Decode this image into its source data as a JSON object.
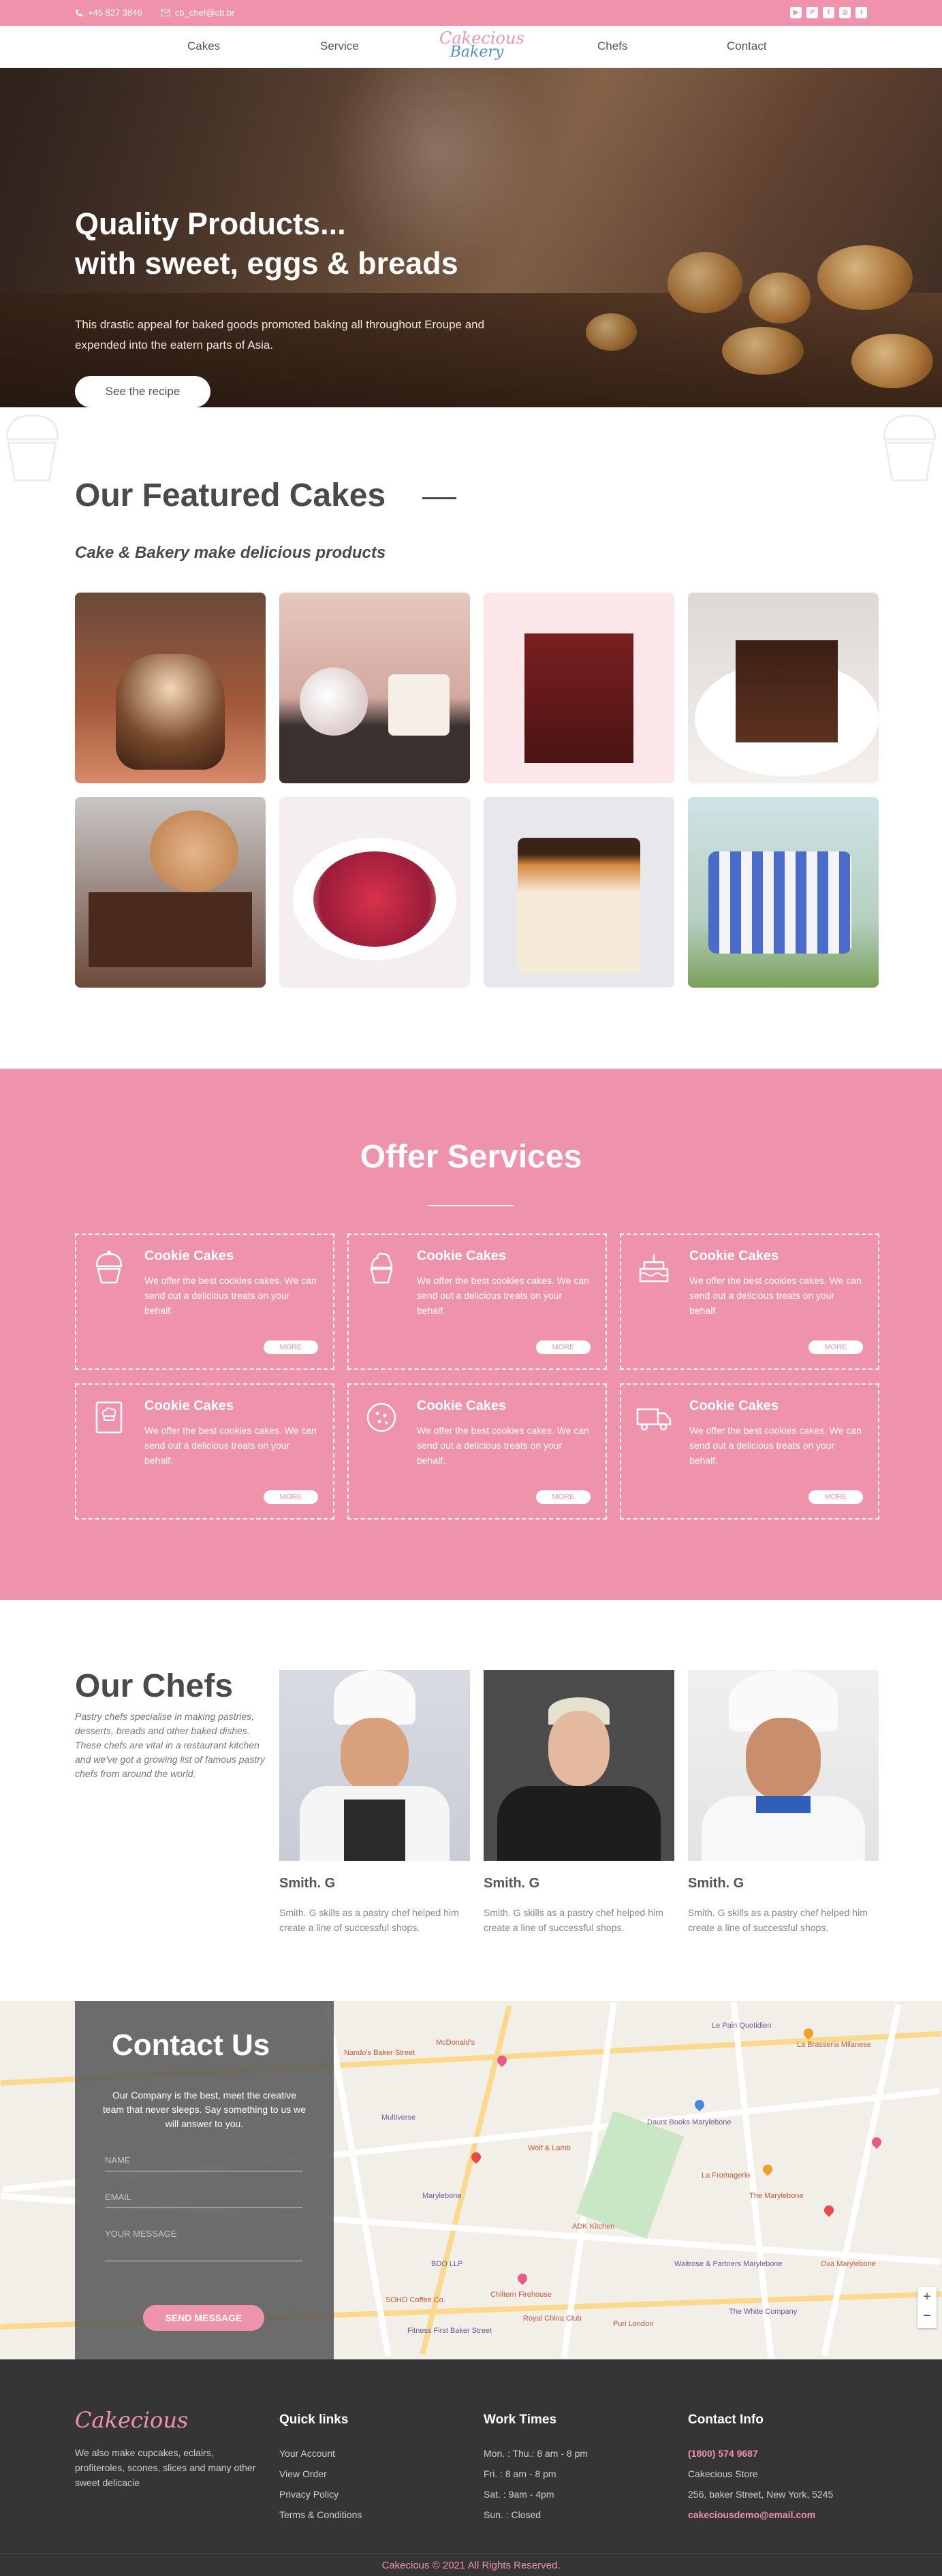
{
  "topbar": {
    "phone": "+45 827 3846",
    "email": "cb_chef@cb.br",
    "socials": [
      "youtube-icon",
      "pinterest-icon",
      "facebook-icon",
      "instagram-icon",
      "twitter-icon"
    ]
  },
  "nav": {
    "items": [
      "Cakes",
      "Service",
      "Chefs",
      "Contact"
    ],
    "logo_line1": "Cakecious",
    "logo_line2": "Bakery"
  },
  "hero": {
    "title_line1": "Quality Products...",
    "title_line2": "with sweet, eggs & breads",
    "description": "This drastic appeal for baked goods promoted baking all throughout Eroupe and expended into the eatern parts of Asia.",
    "button": "See the recipe"
  },
  "featured": {
    "title": "Our Featured Cakes",
    "subtitle": "Cake & Bakery make delicious products"
  },
  "services": {
    "title": "Offer Services",
    "cards": [
      {
        "title": "Cookie Cakes",
        "description": "We offer the best cookies cakes. We can send out a delicious treats on your behalf.",
        "more": "MORE",
        "icon": "cupcake-icon"
      },
      {
        "title": "Cookie Cakes",
        "description": "We offer the best cookies cakes. We can send out a delicious treats on your behalf.",
        "more": "MORE",
        "icon": "cupcake-swirl-icon"
      },
      {
        "title": "Cookie Cakes",
        "description": "We offer the best cookies cakes. We can send out a delicious treats on your behalf.",
        "more": "MORE",
        "icon": "birthday-cake-icon"
      },
      {
        "title": "Cookie Cakes",
        "description": "We offer the best cookies cakes. We can send out a delicious treats on your behalf.",
        "more": "MORE",
        "icon": "chef-book-icon"
      },
      {
        "title": "Cookie Cakes",
        "description": "We offer the best cookies cakes. We can send out a delicious treats on your behalf.",
        "more": "MORE",
        "icon": "cookie-icon"
      },
      {
        "title": "Cookie Cakes",
        "description": "We offer the best cookies cakes. We can send out a delicious treats on your behalf.",
        "more": "MORE",
        "icon": "delivery-truck-icon"
      }
    ]
  },
  "chefs": {
    "title": "Our Chefs",
    "intro": "Pastry chefs specialise in making pastries, desserts, breads and other baked dishes. These chefs are vital in a restaurant kitchen and we've got a growing list of famous pastry chefs from around the world.",
    "list": [
      {
        "name": "Smith. G",
        "description": "Smith. G skills as a pastry chef helped him create a line of successful shops."
      },
      {
        "name": "Smith. G",
        "description": "Smith. G skills as a pastry chef helped him create a line of successful shops."
      },
      {
        "name": "Smith. G",
        "description": "Smith. G skills as a pastry chef helped him create a line of successful shops."
      }
    ]
  },
  "contact": {
    "title": "Contact Us",
    "description": "Our Company is the best, meet the creative team that never sleeps. Say something to us we will answer to you.",
    "name_placeholder": "NAME",
    "email_placeholder": "EMAIL",
    "message_placeholder": "YOUR MESSAGE",
    "button": "SEND MESSAGE",
    "map_labels": [
      "Nando's Baker Street",
      "McDonald's",
      "Marylebone",
      "Wolf & Lamb",
      "Daunt Books Marylebone",
      "La Fromagerie",
      "The Marylebone",
      "Chiltern Firehouse",
      "Fitness First Baker Street",
      "The White Company",
      "BDO LLP",
      "SOHO Coffee Co.",
      "Royal China Club",
      "Waitrose & Partners Marylebone",
      "Oxa Marylebone",
      "La Brasseria Milanese",
      "Le Pain Quotidien",
      "Puri London",
      "ADK Kitchen",
      "Multiverse"
    ]
  },
  "footer": {
    "logo": "Cakecious",
    "about": "We also make cupcakes, eclairs, profiteroles, scones, slices and many other sweet delicacie",
    "quick_links_title": "Quick links",
    "quick_links": [
      "Your Account",
      "View Order",
      "Privacy Policy",
      "Terms & Conditions"
    ],
    "work_times_title": "Work Times",
    "work_times": [
      "Mon. : Thu.: 8 am - 8 pm",
      "Fri. : 8 am - 8 pm",
      "Sat. : 9am - 4pm",
      "Sun. : Closed"
    ],
    "contact_title": "Contact Info",
    "contact_phone": "(1800) 574 9687",
    "contact_store": "Cakecious Store",
    "contact_address": "256, baker Street, New York, 5245",
    "contact_email": "cakeciousdemo@email.com",
    "copyright": "Cakecious © 2021 All Rights Reserved."
  },
  "colors": {
    "accent": "#ef93ad",
    "footer_bg": "#353535",
    "logo_blue": "#4d8fc7"
  }
}
